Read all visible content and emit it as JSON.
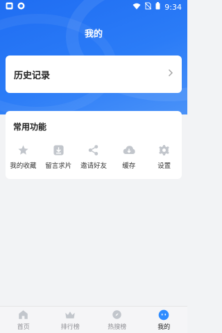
{
  "status": {
    "time": "9:34"
  },
  "header": {
    "title": "我的"
  },
  "history": {
    "title": "历史记录"
  },
  "functions": {
    "title": "常用功能",
    "items": [
      {
        "label": "我的收藏",
        "icon": "star-icon"
      },
      {
        "label": "留言求片",
        "icon": "download-box-icon"
      },
      {
        "label": "邀请好友",
        "icon": "share-icon"
      },
      {
        "label": "缓存",
        "icon": "cloud-download-icon"
      },
      {
        "label": "设置",
        "icon": "gear-icon"
      }
    ]
  },
  "tabs": [
    {
      "label": "首页",
      "icon": "home-icon"
    },
    {
      "label": "排行榜",
      "icon": "crown-icon"
    },
    {
      "label": "热搜榜",
      "icon": "compass-icon"
    },
    {
      "label": "我的",
      "icon": "profile-face-icon",
      "active": true
    }
  ],
  "colors": {
    "brand": "#2b7cf7",
    "icon_gray": "#c2c6cc",
    "tab_active": "#2f8cff"
  }
}
